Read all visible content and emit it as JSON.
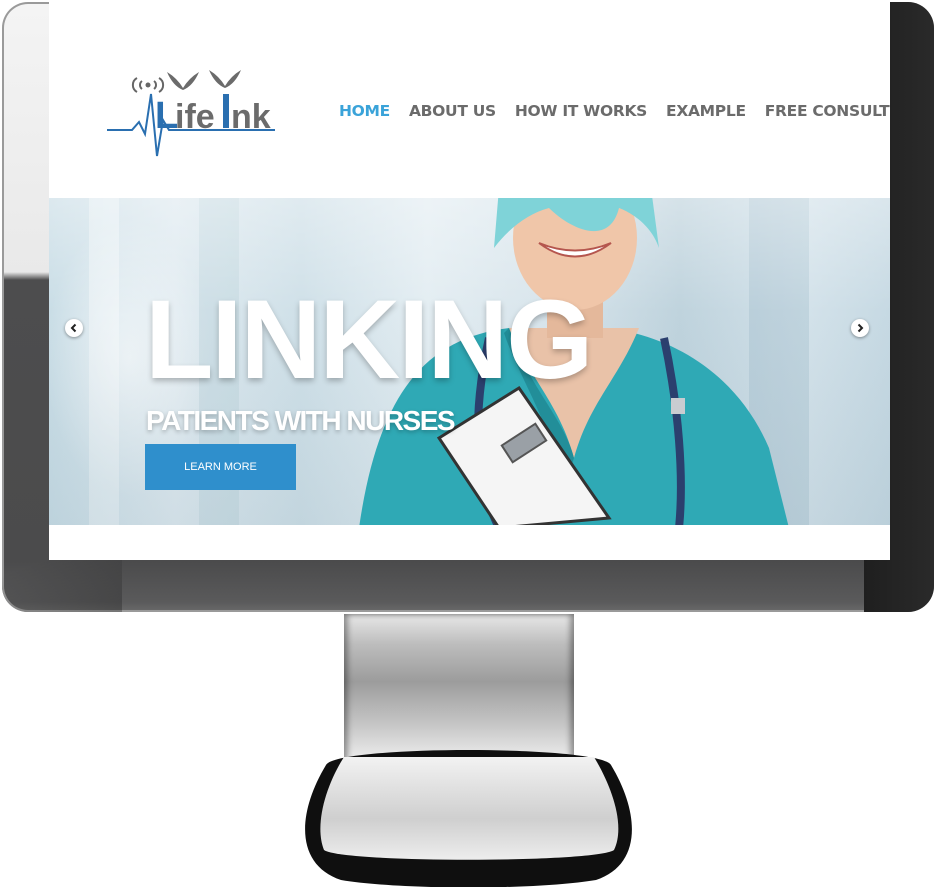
{
  "header": {
    "logo_text": "LifeInk",
    "nav": [
      {
        "label": "HOME",
        "active": true
      },
      {
        "label": "ABOUT US",
        "active": false
      },
      {
        "label": "HOW IT WORKS",
        "active": false
      },
      {
        "label": "EXAMPLE",
        "active": false
      },
      {
        "label": "FREE CONSULT",
        "active": false
      }
    ]
  },
  "hero": {
    "title": "LINKING",
    "subtitle": "PATIENTS WITH NURSES",
    "button_label": "LEARN MORE",
    "prev_icon": "chevron-left-icon",
    "next_icon": "chevron-right-icon"
  },
  "colors": {
    "accent": "#3aa3d9",
    "button": "#2f8fcc",
    "nav_text": "#6b6b6b",
    "scrubs": "#2fa9b5"
  }
}
